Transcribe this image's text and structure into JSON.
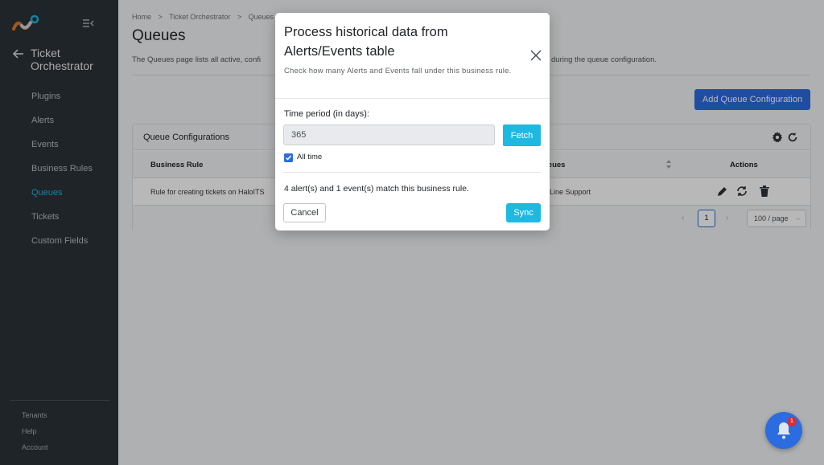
{
  "sidebar": {
    "section_title": "Ticket Orchestrator",
    "items": [
      {
        "label": "Plugins"
      },
      {
        "label": "Alerts"
      },
      {
        "label": "Events"
      },
      {
        "label": "Business Rules"
      },
      {
        "label": "Queues",
        "active": true
      },
      {
        "label": "Tickets"
      },
      {
        "label": "Custom Fields"
      }
    ],
    "footer": [
      {
        "label": "Tenants"
      },
      {
        "label": "Help"
      },
      {
        "label": "Account"
      }
    ]
  },
  "main": {
    "breadcrumb": [
      "Home",
      ">",
      "Ticket Orchestrator",
      ">",
      "Queues"
    ],
    "title": "Queues",
    "description_left": "The Queues page lists all active, confi",
    "description_right": "during the queue configuration.",
    "add_button": "Add Queue Configuration",
    "card": {
      "title": "Queue Configurations",
      "columns": {
        "rule": "Business Rule",
        "queues": "ueues",
        "actions": "Actions"
      },
      "row": {
        "rule": "Rule for creating tickets on HaloITS",
        "queues": "Line Support"
      },
      "pager": {
        "current_page": "1",
        "page_size": "100 / page"
      }
    }
  },
  "modal": {
    "title": "Process historical data from Alerts/Events table",
    "subtitle": "Check how many Alerts and Events fall under this business rule.",
    "time_period_label": "Time period (in days):",
    "time_period_value": "365",
    "fetch_label": "Fetch",
    "all_time_label": "All time",
    "all_time_checked": true,
    "match_text": "4 alert(s) and 1 event(s) match this business rule.",
    "cancel_label": "Cancel",
    "sync_label": "Sync"
  },
  "notifications": {
    "badge_count": "1"
  },
  "colors": {
    "accent": "#1eb9e0",
    "primary": "#2b6de0",
    "sidebar_bg": "#2b3238",
    "badge": "#d62f3a"
  }
}
